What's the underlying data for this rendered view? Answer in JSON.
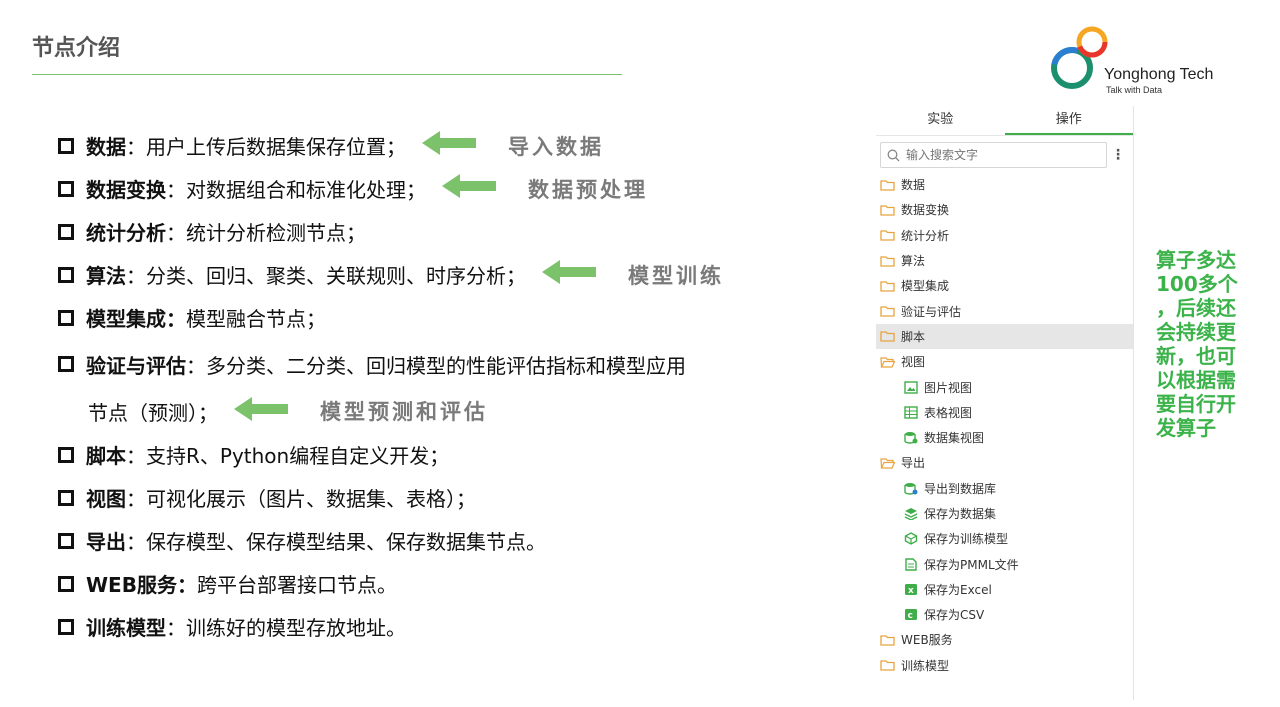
{
  "title": "节点介绍",
  "logo": {
    "name": "Yonghong Tech",
    "tagline": "Talk with Data"
  },
  "bullets": [
    {
      "term": "数据",
      "desc": "：用户上传后数据集保存位置；",
      "arrow_label": "导入数据"
    },
    {
      "term": "数据变换",
      "desc": "：对数据组合和标准化处理；",
      "arrow_label": "数据预处理"
    },
    {
      "term": "统计分析",
      "desc": "：统计分析检测节点；"
    },
    {
      "term": "算法",
      "desc": "：分类、回归、聚类、关联规则、时序分析；",
      "arrow_label": "模型训练"
    },
    {
      "term": "模型集成：",
      "desc": "模型融合节点；"
    },
    {
      "term": "验证与评估",
      "desc": "：多分类、二分类、回归模型的性能评估指标和模型应用",
      "cont": "节点（预测）；",
      "arrow_label": "模型预测和评估"
    },
    {
      "term": "脚本",
      "desc": "：支持R、Python编程自定义开发；"
    },
    {
      "term": "视图",
      "desc": "：可视化展示（图片、数据集、表格）；"
    },
    {
      "term": "导出",
      "desc": "：保存模型、保存模型结果、保存数据集节点。"
    },
    {
      "term": "WEB服务：",
      "desc": "跨平台部署接口节点。"
    },
    {
      "term": "训练模型",
      "desc": "：训练好的模型存放地址。"
    }
  ],
  "panel": {
    "tabs": [
      "实验",
      "操作"
    ],
    "active_tab": "操作",
    "search_placeholder": "输入搜索文字",
    "items": [
      {
        "label": "数据",
        "icon": "folder-icon"
      },
      {
        "label": "数据变换",
        "icon": "folder-icon"
      },
      {
        "label": "统计分析",
        "icon": "folder-icon"
      },
      {
        "label": "算法",
        "icon": "folder-icon"
      },
      {
        "label": "模型集成",
        "icon": "folder-icon"
      },
      {
        "label": "验证与评估",
        "icon": "folder-icon"
      },
      {
        "label": "脚本",
        "icon": "folder-icon",
        "selected": true
      },
      {
        "label": "视图",
        "icon": "folder-open-icon"
      },
      {
        "label": "图片视图",
        "icon": "image-view-icon",
        "child": true
      },
      {
        "label": "表格视图",
        "icon": "table-view-icon",
        "child": true
      },
      {
        "label": "数据集视图",
        "icon": "dataset-view-icon",
        "child": true
      },
      {
        "label": "导出",
        "icon": "folder-open-icon"
      },
      {
        "label": "导出到数据库",
        "icon": "export-db-icon",
        "child": true
      },
      {
        "label": "保存为数据集",
        "icon": "save-dataset-icon",
        "child": true
      },
      {
        "label": "保存为训练模型",
        "icon": "save-model-icon",
        "child": true
      },
      {
        "label": "保存为PMML文件",
        "icon": "save-pmml-icon",
        "child": true
      },
      {
        "label": "保存为Excel",
        "icon": "save-excel-icon",
        "child": true
      },
      {
        "label": "保存为CSV",
        "icon": "save-csv-icon",
        "child": true
      },
      {
        "label": "WEB服务",
        "icon": "folder-icon"
      },
      {
        "label": "训练模型",
        "icon": "folder-icon"
      }
    ]
  },
  "callout": [
    "算子多达",
    "100多个",
    "，后续还",
    "会持续更",
    "新，也可",
    "以根据需",
    "要自行开",
    "发算子"
  ],
  "colors": {
    "accent_green": "#3cb34a",
    "arrow_green": "#7cc26b",
    "label_gray": "#7a7a7a"
  }
}
